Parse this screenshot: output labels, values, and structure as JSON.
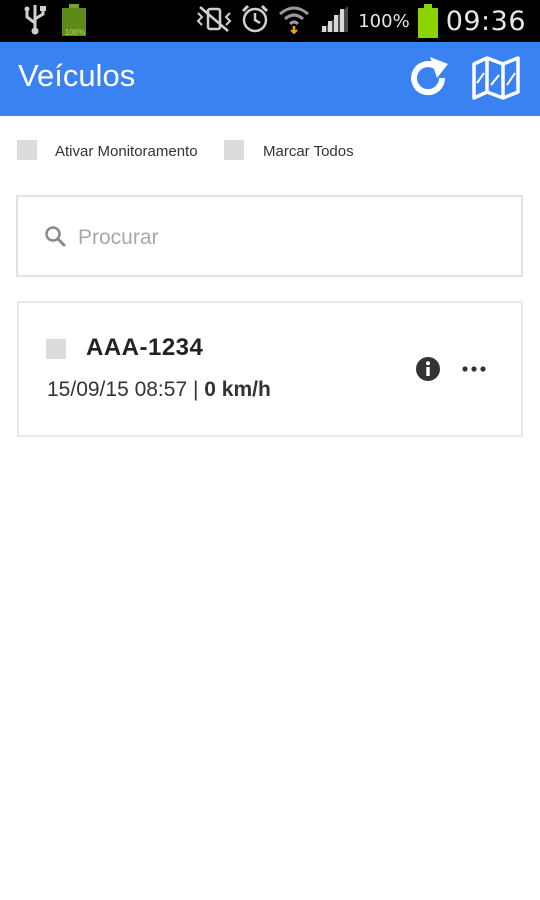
{
  "status_bar": {
    "battery_mini_label": "100%",
    "battery_percent": "100%",
    "time": "09:36",
    "icons": [
      "usb-icon",
      "battery-mini-icon",
      "mute-vibrate-icon",
      "alarm-icon",
      "wifi-icon",
      "signal-icon",
      "battery-icon"
    ]
  },
  "app_bar": {
    "title": "Veículos",
    "background": "#3a82f1",
    "actions": [
      "refresh-icon",
      "map-icon"
    ]
  },
  "options": {
    "monitor_label": "Ativar Monitoramento",
    "select_all_label": "Marcar Todos",
    "monitor_checked": false,
    "select_all_checked": false
  },
  "search": {
    "placeholder": "Procurar",
    "value": ""
  },
  "vehicles": [
    {
      "plate": "AAA-1234",
      "datetime": "15/09/15 08:57",
      "separator": " | ",
      "speed": "0 km/h",
      "checked": false
    }
  ]
}
